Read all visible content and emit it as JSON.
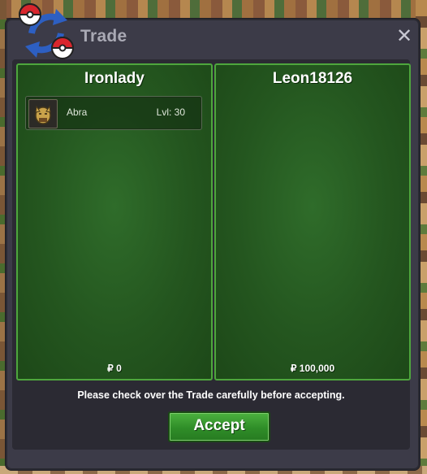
{
  "window": {
    "title": "Trade",
    "close_glyph": "✕",
    "logo_icon": "pokeball-swap-icon"
  },
  "offers": [
    {
      "player": "Ironlady",
      "items": [
        {
          "name": "Abra",
          "level": "Lvl: 30",
          "icon": "abra-sprite-icon"
        }
      ],
      "money": "₽ 0"
    },
    {
      "player": "Leon18126",
      "items": [],
      "money": "₽ 100,000"
    }
  ],
  "notice": "Please check over the Trade carefully before accepting.",
  "accept_label": "Accept",
  "colors": {
    "window_bg": "#3c3b48",
    "panel_green": "#2f6c2a",
    "panel_border": "#4ea63d",
    "accept_green": "#3a9e31"
  }
}
